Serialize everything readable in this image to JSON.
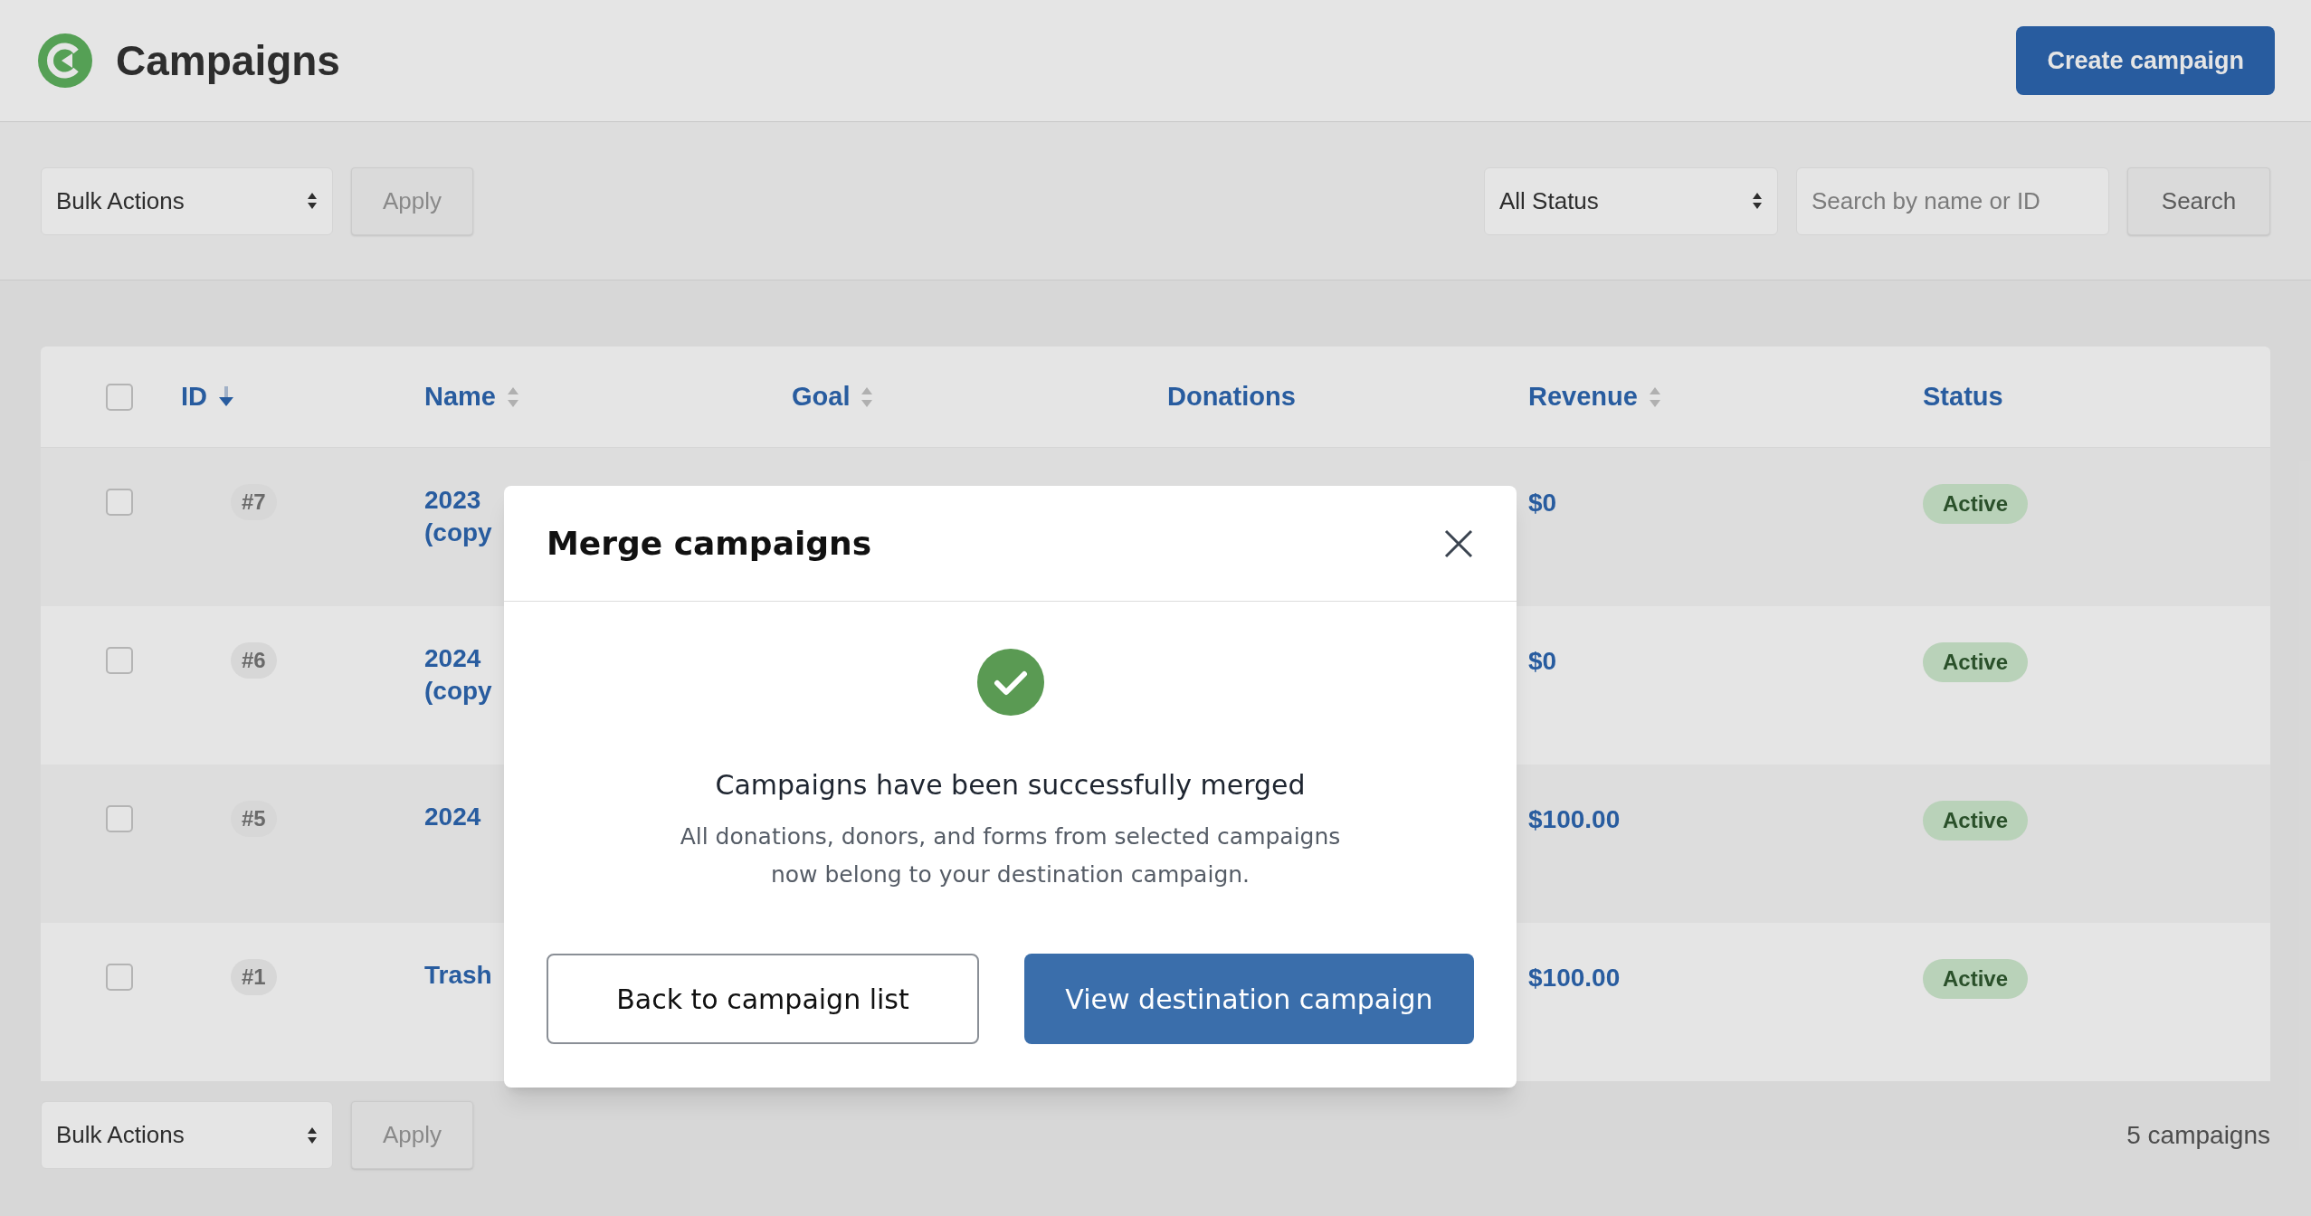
{
  "header": {
    "title": "Campaigns",
    "create_button": "Create campaign"
  },
  "toolbar": {
    "bulk_actions": "Bulk Actions",
    "apply": "Apply",
    "status_filter": "All Status",
    "search_placeholder": "Search by name or ID",
    "search_button": "Search"
  },
  "table": {
    "header_checkbox": {
      "checked": false
    },
    "columns": [
      {
        "kind": "sortable",
        "label": "ID",
        "sorted": true
      },
      {
        "kind": "sortable",
        "label": "Name",
        "sorted": false
      },
      {
        "kind": "sortable",
        "label": "Goal",
        "sorted": false
      },
      {
        "kind": "plain",
        "label": "Donations"
      },
      {
        "kind": "sortable",
        "label": "Revenue",
        "sorted": false
      },
      {
        "kind": "plain",
        "label": "Status"
      }
    ],
    "rows": [
      {
        "checked": false,
        "id": "#7",
        "name": [
          "2023",
          "(copy"
        ],
        "revenue": "$0",
        "status": "Active"
      },
      {
        "checked": false,
        "id": "#6",
        "name": [
          "2024",
          "(copy"
        ],
        "revenue": "$0",
        "status": "Active"
      },
      {
        "checked": false,
        "id": "#5",
        "name": [
          "2024"
        ],
        "revenue": "$100.00",
        "status": "Active"
      },
      {
        "checked": false,
        "id": "#1",
        "name": [
          "Trash"
        ],
        "revenue": "$100.00",
        "status": "Active"
      }
    ]
  },
  "footer": {
    "bulk_actions": "Bulk Actions",
    "apply": "Apply",
    "count": "5 campaigns"
  },
  "modal": {
    "title": "Merge campaigns",
    "heading": "Campaigns have been successfully merged",
    "message": [
      "All donations, donors, and forms from selected campaigns",
      "now belong to your destination campaign."
    ],
    "secondary_button": "Back to campaign list",
    "primary_button": "View destination campaign"
  }
}
